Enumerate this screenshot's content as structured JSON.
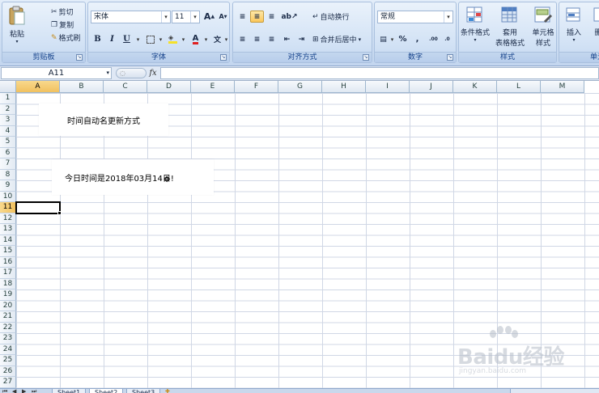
{
  "ribbon": {
    "clipboard": {
      "paste_label": "粘贴",
      "cut_label": "剪切",
      "copy_label": "复制",
      "format_painter_label": "格式刷",
      "group_label": "剪贴板"
    },
    "font": {
      "font_name": "宋体",
      "font_size": "11",
      "grow_label": "A",
      "shrink_label": "A",
      "bold_label": "B",
      "italic_label": "I",
      "underline_label": "U",
      "font_color_label": "A",
      "phonetic_label": "文",
      "group_label": "字体"
    },
    "alignment": {
      "wrap_text_label": "自动换行",
      "merge_center_label": "合并后居中",
      "group_label": "对齐方式"
    },
    "number": {
      "format_value": "常规",
      "percent_label": "%",
      "comma_label": ",",
      "inc_decimal_label": ".00",
      "dec_decimal_label": ".0",
      "group_label": "数字"
    },
    "styles": {
      "conditional_label": "条件格式",
      "table_format_line1": "套用",
      "table_format_line2": "表格格式",
      "cell_styles_line1": "单元格",
      "cell_styles_line2": "样式",
      "group_label": "样式"
    },
    "cells": {
      "insert_label": "插入",
      "delete_label": "删",
      "group_label": "单元"
    }
  },
  "formula_bar": {
    "name_box": "A11",
    "fx_label": "fx",
    "formula_value": ""
  },
  "columns": [
    "A",
    "B",
    "C",
    "D",
    "E",
    "F",
    "G",
    "H",
    "I",
    "J",
    "K",
    "L",
    "M"
  ],
  "selected_column": "A",
  "rows": [
    "1",
    "2",
    "3",
    "4",
    "5",
    "6",
    "7",
    "8",
    "9",
    "10",
    "11",
    "12",
    "13",
    "14",
    "15",
    "16",
    "17",
    "18",
    "19",
    "20",
    "21",
    "22",
    "23",
    "24",
    "25",
    "26",
    "27"
  ],
  "selected_row": "11",
  "textboxes": {
    "title": "时间自动名更新方式",
    "message": "今日时间是2018年03月14日!"
  },
  "sheet_tabs": [
    "Sheet1",
    "Sheet2",
    "Sheet3"
  ],
  "active_sheet": "Sheet2",
  "watermark": {
    "brand": "Baidu经验",
    "url": "jingyan.baidu.com"
  },
  "colors": {
    "ribbon_bg": "#cfdff3",
    "selected_header": "#f1c15f",
    "grid_line": "#d0d7e5"
  }
}
